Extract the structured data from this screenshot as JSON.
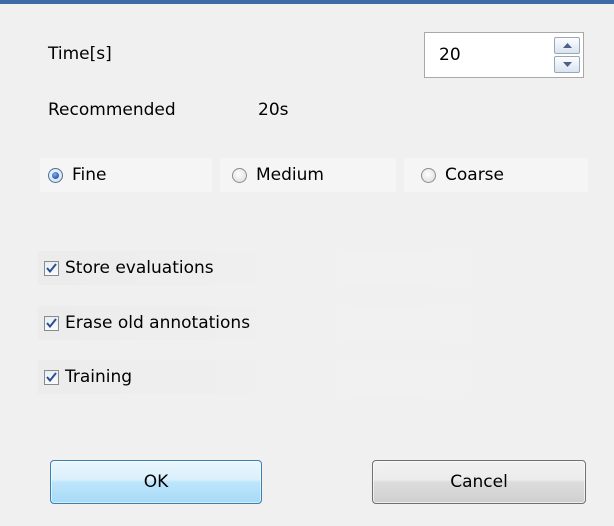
{
  "dialog": {
    "time_label": "Time[s]",
    "time_value": "20",
    "recommended_label": "Recommended",
    "recommended_value": "20s"
  },
  "resolution": {
    "options": [
      {
        "label": "Fine",
        "checked": true
      },
      {
        "label": "Medium",
        "checked": false
      },
      {
        "label": "Coarse",
        "checked": false
      }
    ]
  },
  "options": {
    "store_evaluations": {
      "label": "Store evaluations",
      "checked": true
    },
    "erase_old_annotations": {
      "label": "Erase old annotations",
      "checked": true
    },
    "training": {
      "label": "Training",
      "checked": true
    }
  },
  "buttons": {
    "ok_label": "OK",
    "cancel_label": "Cancel"
  },
  "colors": {
    "title_bar": "#3e6aa6",
    "default_button_border": "#3c7fb1",
    "check_mark": "#2b4f8f"
  }
}
